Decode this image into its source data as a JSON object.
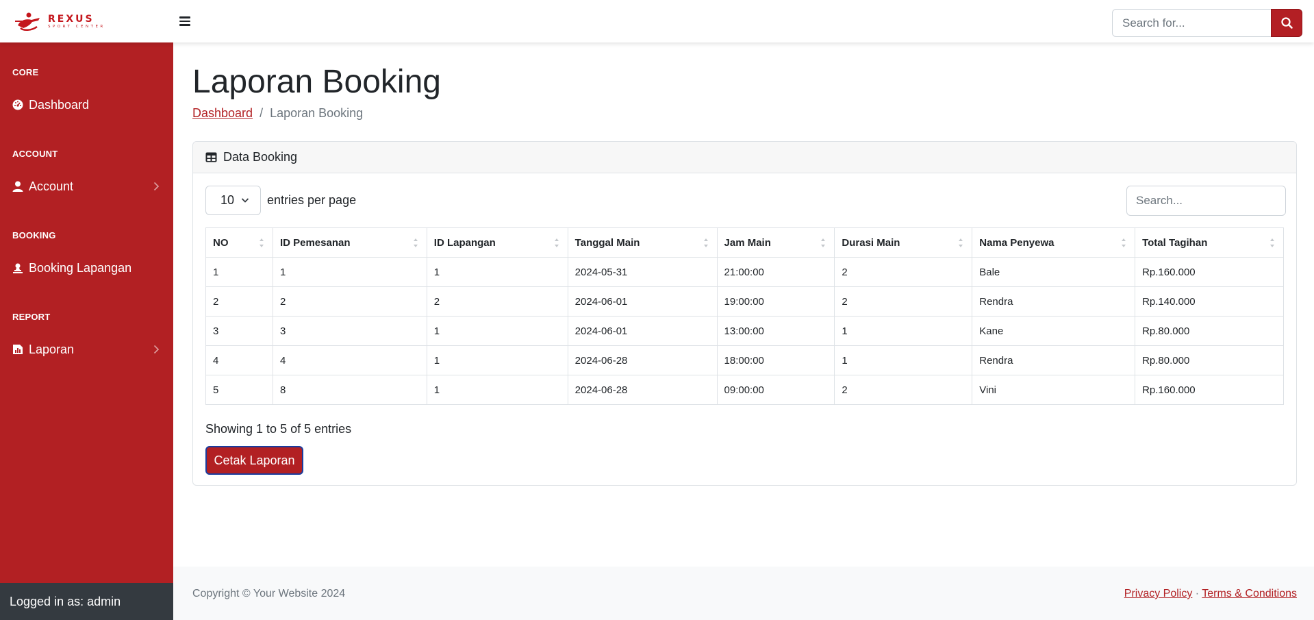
{
  "brand": {
    "name": "REXUS",
    "sub": "SPORT CENTER",
    "color": "#c4161c"
  },
  "header": {
    "search_placeholder": "Search for..."
  },
  "sidebar": {
    "sections": [
      {
        "heading": "CORE",
        "item": {
          "label": "Dashboard",
          "icon": "tachometer-icon",
          "has_submenu": false
        }
      },
      {
        "heading": "ACCOUNT",
        "item": {
          "label": "Account",
          "icon": "user-icon",
          "has_submenu": true
        }
      },
      {
        "heading": "BOOKING",
        "item": {
          "label": "Booking Lapangan",
          "icon": "booking-icon",
          "has_submenu": false
        }
      },
      {
        "heading": "REPORT",
        "item": {
          "label": "Laporan",
          "icon": "report-chart-icon",
          "has_submenu": true
        }
      }
    ],
    "footer": "Logged in as: admin",
    "color": "#b22023"
  },
  "page": {
    "title": "Laporan Booking",
    "breadcrumb": {
      "link": "Dashboard",
      "separator": "/",
      "current": "Laporan Booking"
    }
  },
  "card": {
    "header": "Data Booking",
    "entries_value": "10",
    "entries_label": "entries per page",
    "search_placeholder": "Search...",
    "table": {
      "columns": [
        "NO",
        "ID Pemesanan",
        "ID Lapangan",
        "Tanggal Main",
        "Jam Main",
        "Durasi Main",
        "Nama Penyewa",
        "Total Tagihan"
      ],
      "rows": [
        [
          "1",
          "1",
          "1",
          "2024-05-31",
          "21:00:00",
          "2",
          "Bale",
          "Rp.160.000"
        ],
        [
          "2",
          "2",
          "2",
          "2024-06-01",
          "19:00:00",
          "2",
          "Rendra",
          "Rp.140.000"
        ],
        [
          "3",
          "3",
          "1",
          "2024-06-01",
          "13:00:00",
          "1",
          "Kane",
          "Rp.80.000"
        ],
        [
          "4",
          "4",
          "1",
          "2024-06-28",
          "18:00:00",
          "1",
          "Rendra",
          "Rp.80.000"
        ],
        [
          "5",
          "8",
          "1",
          "2024-06-28",
          "09:00:00",
          "2",
          "Vini",
          "Rp.160.000"
        ]
      ]
    },
    "info": "Showing 1 to 5 of 5 entries",
    "print_button": "Cetak Laporan"
  },
  "footer": {
    "copyright": "Copyright © Your Website 2024",
    "privacy": "Privacy Policy",
    "separator": "·",
    "terms": "Terms & Conditions"
  }
}
